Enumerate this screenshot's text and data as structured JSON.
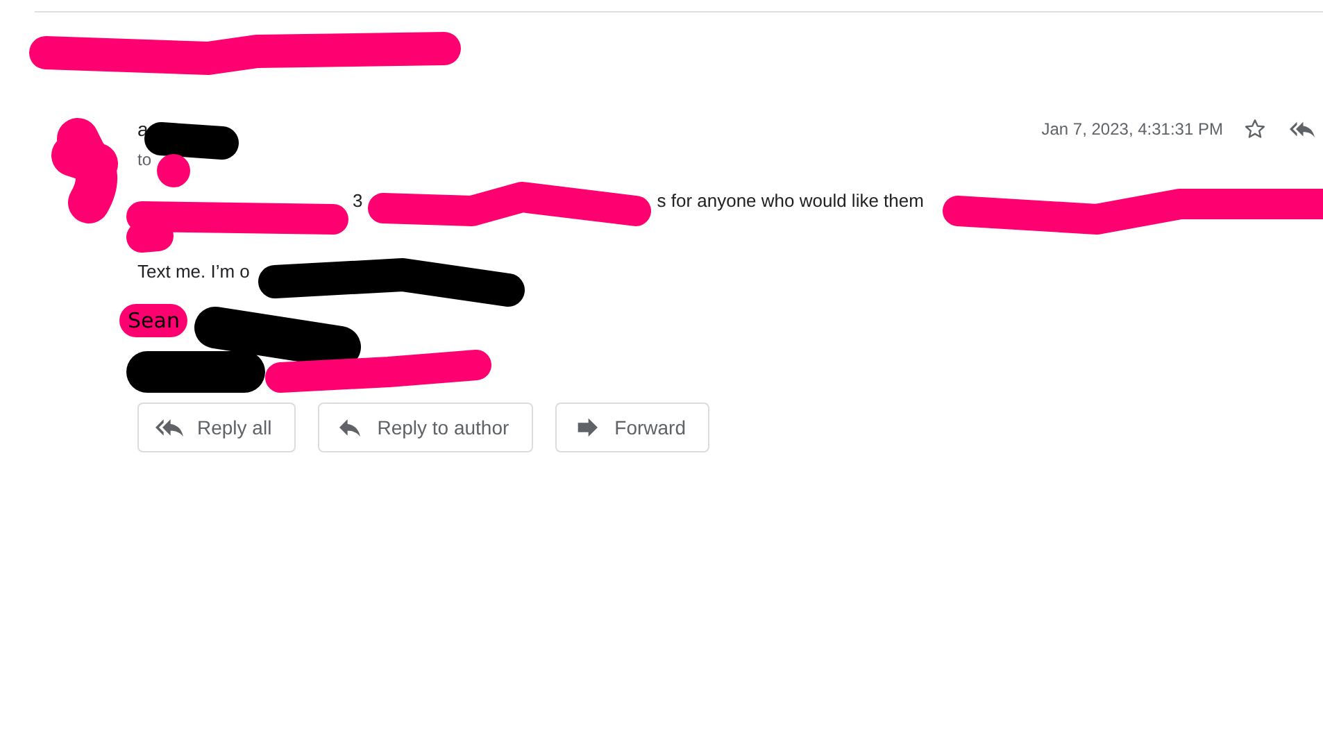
{
  "message": {
    "sender": "a",
    "to_label": "to",
    "date": "Jan 7, 2023, 4:31:31 PM",
    "body_lines": [
      {
        "fragments": [
          "3",
          "s for anyone who would like them"
        ]
      },
      {
        "fragments": [
          "Text me. I’m o"
        ]
      }
    ],
    "signature": "Sean"
  },
  "buttons": [
    {
      "label": "Reply all",
      "kind": "reply-all"
    },
    {
      "label": "Reply to author",
      "kind": "reply"
    },
    {
      "label": "Forward",
      "kind": "forward"
    }
  ],
  "redactions": [
    {
      "color": "#ff0070"
    },
    {
      "color": "#ff0070"
    },
    {
      "color": "#000000"
    },
    {
      "color": "#ff0070"
    },
    {
      "color": "#ff0070"
    },
    {
      "color": "#ff0070"
    },
    {
      "color": "#ff0070"
    },
    {
      "color": "#000000"
    },
    {
      "color": "#000000"
    },
    {
      "color": "#ff0070"
    }
  ]
}
